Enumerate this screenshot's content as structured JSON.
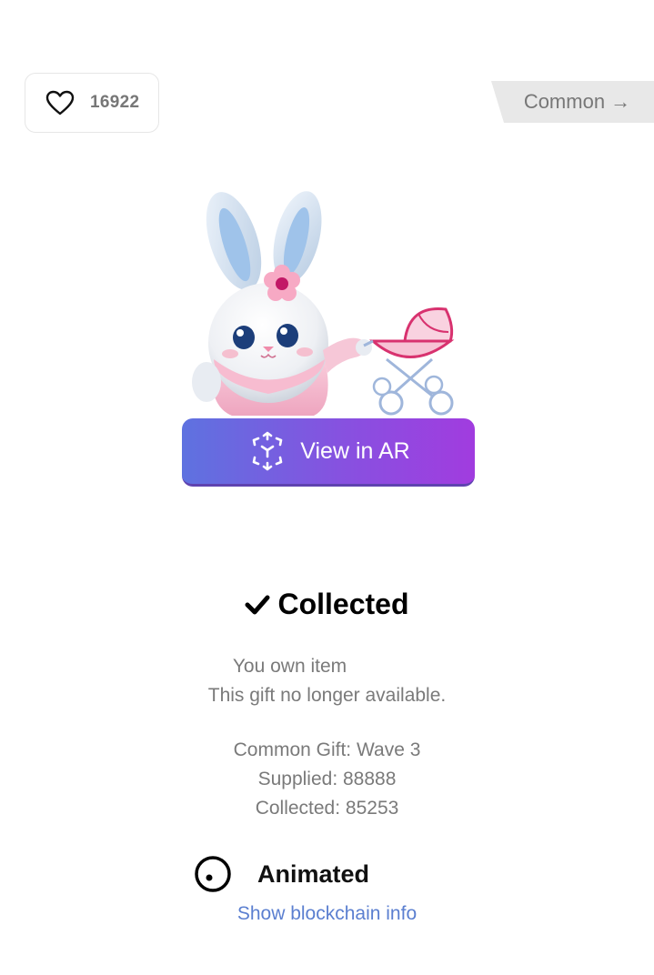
{
  "likes": {
    "count": "16922",
    "icon": "heart-outline-icon"
  },
  "rarity": {
    "label": "Common →"
  },
  "gift": {
    "image_alt": "bunny with pink stroller",
    "ar_button_label": "View in AR",
    "ar_icon": "ar-cube-icon"
  },
  "status": {
    "title": "Collected",
    "check_icon": "checkmark-icon",
    "own_text": "You own item",
    "availability_text": "This gift no longer available."
  },
  "details": {
    "series": "Common Gift: Wave 3",
    "supplied": "Supplied: 88888",
    "collected": "Collected: 85253"
  },
  "animated": {
    "label": "Animated",
    "icon": "animated-indicator-icon"
  },
  "blockchain": {
    "link_label": "Show blockchain info"
  },
  "colors": {
    "ar_gradient_start": "#5e72e0",
    "ar_gradient_end": "#a13cdf",
    "link": "#5b7fd0",
    "muted_text": "#7a7a7a"
  }
}
